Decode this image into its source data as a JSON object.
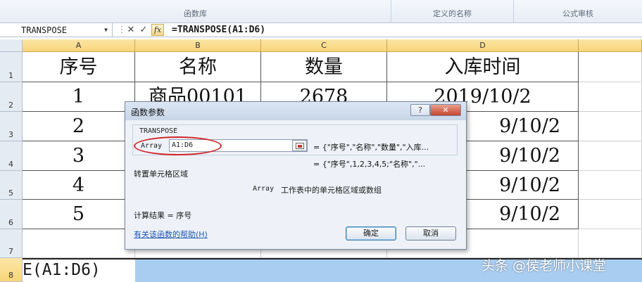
{
  "ribbon": {
    "groups": [
      "函数库",
      "定义的名称",
      "公式审核"
    ]
  },
  "formula_bar": {
    "name_box": "TRANSPOSE",
    "cancel_symbol": "✕",
    "enter_symbol": "✓",
    "fx_label": "fx",
    "formula": "=TRANSPOSE(A1:D6)"
  },
  "sheet": {
    "columns": [
      "A",
      "B",
      "C",
      "D"
    ],
    "rows": [
      "1",
      "2",
      "3",
      "4",
      "5",
      "6",
      "7",
      "8"
    ],
    "cells": [
      [
        "序号",
        "名称",
        "数量",
        "入库时间"
      ],
      [
        "1",
        "商品00101",
        "2678",
        "2019/10/2"
      ],
      [
        "2",
        "",
        "",
        "9/10/2"
      ],
      [
        "3",
        "",
        "",
        "9/10/2"
      ],
      [
        "4",
        "",
        "",
        "9/10/2"
      ],
      [
        "5",
        "",
        "",
        "9/10/2"
      ]
    ],
    "row8_text": "E(A1:D6)"
  },
  "dialog": {
    "title": "函数参数",
    "help_symbol": "?",
    "close_symbol": "✕",
    "function_name": "TRANSPOSE",
    "arg_name": "Array",
    "arg_value": "A1:D6",
    "arg_preview": "= {\"序号\",\"名称\",\"数量\",\"入库...",
    "result_preview": "= {\"序号\",1,2,3,4,5;\"名称\",\"...",
    "description": "转置单元格区域",
    "arg_desc_name": "Array",
    "arg_desc_text": "工作表中的单元格区域或数组",
    "result_label": "计算结果 = 序号",
    "help_link": "有关该函数的帮助(H)",
    "ok": "确定",
    "cancel": "取消"
  },
  "watermark": "头条 @侯老师小课堂",
  "colors": {
    "selected_header": "#f8d57a",
    "selection": "#a9cdf0",
    "highlight_oval": "#d0262b",
    "link": "#1d55b4"
  }
}
